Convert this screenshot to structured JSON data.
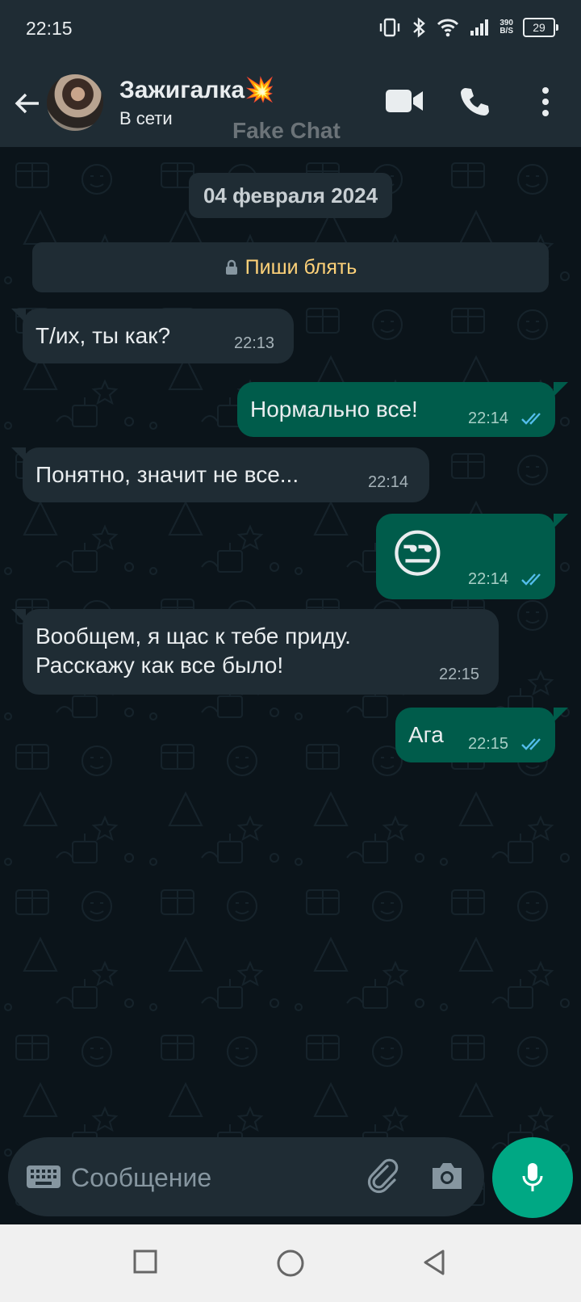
{
  "status_bar": {
    "time": "22:15",
    "speed_value": "390",
    "speed_unit": "B/S",
    "battery": "29"
  },
  "header": {
    "contact_name": "Зажигалка💥",
    "contact_status": "В сети",
    "watermark": "Fake Chat",
    "icons": [
      "back-arrow-icon",
      "video-call-icon",
      "voice-call-icon",
      "more-vert-icon"
    ]
  },
  "chat": {
    "date_chip": "04 февраля 2024",
    "notice": "Пиши блять",
    "messages": [
      {
        "direction": "in",
        "text": "Т/их, ты как?",
        "time": "22:13"
      },
      {
        "direction": "out",
        "text": "Нормально все!",
        "time": "22:14",
        "read": true
      },
      {
        "direction": "in",
        "text": "Понятно, значит не все...",
        "time": "22:14"
      },
      {
        "direction": "out",
        "text": "😒",
        "time": "22:14",
        "read": true
      },
      {
        "direction": "in",
        "line1": "Вообщем, я щас к тебе приду.",
        "line2": "Расскажу как все было!",
        "time": "22:15"
      },
      {
        "direction": "out",
        "text": "Ага",
        "time": "22:15",
        "read": true
      }
    ]
  },
  "composer": {
    "placeholder": "Сообщение"
  },
  "colors": {
    "header_bg": "#1f2c34",
    "chat_bg": "#0b141a",
    "incoming": "#1f2c34",
    "outgoing": "#005c4b",
    "accent": "#00a884",
    "read_tick": "#53bdeb"
  }
}
